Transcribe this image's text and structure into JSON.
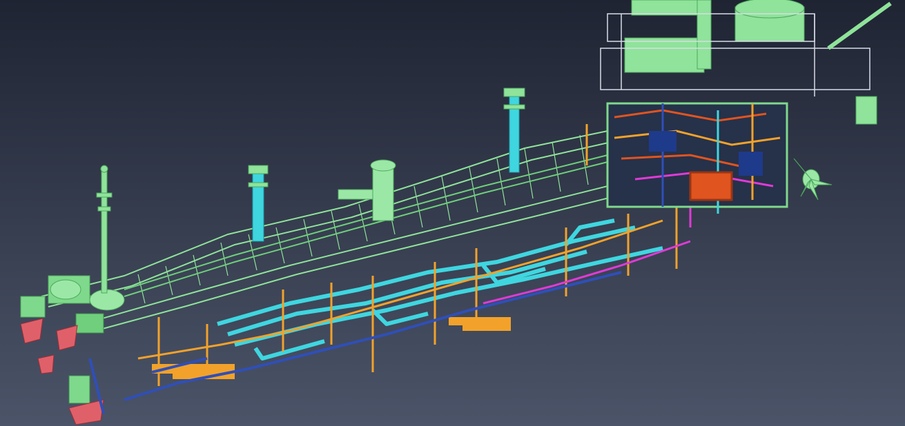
{
  "scene": {
    "kind": "3D CAD piping model of a tanker vessel (no visible text)",
    "background_top": "#1f2433",
    "background_bottom": "#4b5468"
  },
  "colors": {
    "structure_green": "#8fe39a",
    "structure_green_dark": "#5dbf6d",
    "cargo_pipe_cyan": "#3fd6e0",
    "line_orange": "#f2a22a",
    "line_blue": "#2f4fb8",
    "line_magenta": "#e03ad6",
    "line_red_orange": "#e0541f",
    "thruster_red": "#e0606a",
    "rail_white": "#d8dde8",
    "dark_blue_equipment": "#1e3a8a"
  },
  "components": {
    "masts": 4,
    "vent_posts": 2,
    "propellers": 1,
    "bow_thrusters": 3
  }
}
